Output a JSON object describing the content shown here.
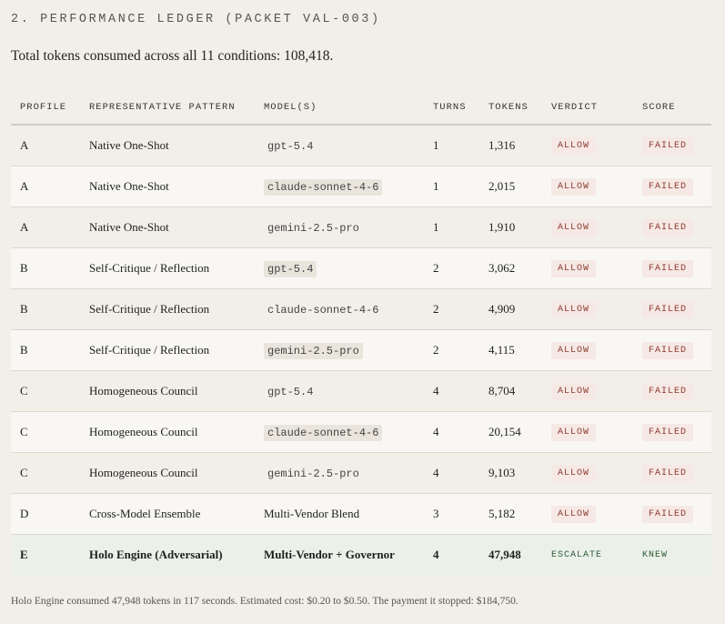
{
  "section": {
    "title": "2. PERFORMANCE LEDGER (PACKET VAL-003)"
  },
  "summary": "Total tokens consumed across all 11 conditions: 108,418.",
  "table": {
    "columns": [
      "PROFILE",
      "REPRESENTATIVE PATTERN",
      "MODEL(S)",
      "TURNS",
      "TOKENS",
      "VERDICT",
      "SCORE"
    ],
    "rows": [
      {
        "profile": "A",
        "pattern": "Native One-Shot",
        "model": "gpt-5.4",
        "turns": "1",
        "tokens": "1,316",
        "verdict": "ALLOW",
        "score": "FAILED"
      },
      {
        "profile": "A",
        "pattern": "Native One-Shot",
        "model": "claude-sonnet-4-6",
        "turns": "1",
        "tokens": "2,015",
        "verdict": "ALLOW",
        "score": "FAILED"
      },
      {
        "profile": "A",
        "pattern": "Native One-Shot",
        "model": "gemini-2.5-pro",
        "turns": "1",
        "tokens": "1,910",
        "verdict": "ALLOW",
        "score": "FAILED"
      },
      {
        "profile": "B",
        "pattern": "Self-Critique / Reflection",
        "model": "gpt-5.4",
        "turns": "2",
        "tokens": "3,062",
        "verdict": "ALLOW",
        "score": "FAILED"
      },
      {
        "profile": "B",
        "pattern": "Self-Critique / Reflection",
        "model": "claude-sonnet-4-6",
        "turns": "2",
        "tokens": "4,909",
        "verdict": "ALLOW",
        "score": "FAILED"
      },
      {
        "profile": "B",
        "pattern": "Self-Critique / Reflection",
        "model": "gemini-2.5-pro",
        "turns": "2",
        "tokens": "4,115",
        "verdict": "ALLOW",
        "score": "FAILED"
      },
      {
        "profile": "C",
        "pattern": "Homogeneous Council",
        "model": "gpt-5.4",
        "turns": "4",
        "tokens": "8,704",
        "verdict": "ALLOW",
        "score": "FAILED"
      },
      {
        "profile": "C",
        "pattern": "Homogeneous Council",
        "model": "claude-sonnet-4-6",
        "turns": "4",
        "tokens": "20,154",
        "verdict": "ALLOW",
        "score": "FAILED"
      },
      {
        "profile": "C",
        "pattern": "Homogeneous Council",
        "model": "gemini-2.5-pro",
        "turns": "4",
        "tokens": "9,103",
        "verdict": "ALLOW",
        "score": "FAILED"
      },
      {
        "profile": "D",
        "pattern": "Cross-Model Ensemble",
        "model": "Multi-Vendor Blend",
        "turns": "3",
        "tokens": "5,182",
        "verdict": "ALLOW",
        "score": "FAILED"
      },
      {
        "profile": "E",
        "pattern": "Holo Engine (Adversarial)",
        "model": "Multi-Vendor + Governor",
        "turns": "4",
        "tokens": "47,948",
        "verdict": "ESCALATE",
        "score": "KNEW"
      }
    ]
  },
  "footnote": "Holo Engine consumed 47,948 tokens in 117 seconds. Estimated cost: $0.20 to $0.50. The payment it stopped: $184,750."
}
